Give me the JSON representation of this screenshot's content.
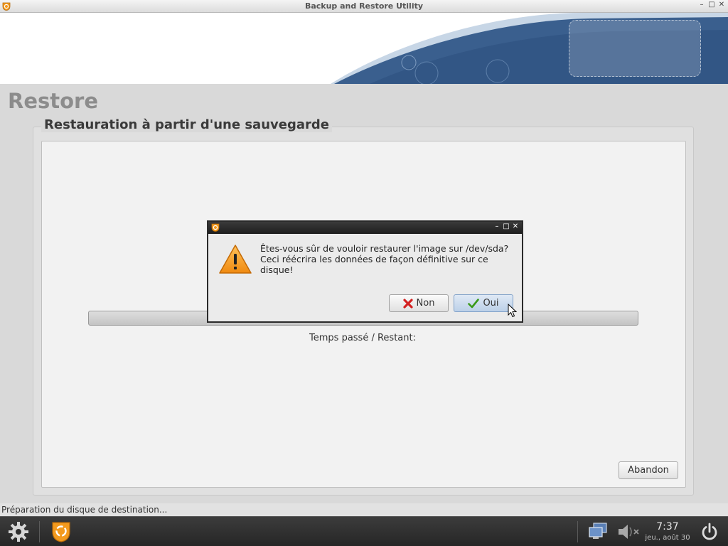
{
  "window": {
    "title": "Backup and Restore Utility",
    "controls": [
      "minimize",
      "maximize",
      "close"
    ]
  },
  "colors": {
    "banner_blue": "#3a5f8e",
    "accent_orange": "#f39a1e",
    "taskbar": "#2e2e2e"
  },
  "page": {
    "heading": "Restore",
    "section_title": "Restauration à partir d'une sauvegarde",
    "progress": 0,
    "time_label": "Temps passé / Restant:",
    "abort_button": "Abandon"
  },
  "status": {
    "text": "Préparation du disque de destination..."
  },
  "dialog": {
    "icon": "warning-icon",
    "message_line1": "Êtes-vous sûr de vouloir restaurer l'image sur /dev/sda?",
    "message_line2": "Ceci réécrira les données de façon définitive sur ce disque!",
    "no_button": "Non",
    "yes_button": "Oui"
  },
  "taskbar": {
    "clock_time": "7:37",
    "clock_date": "jeu., août 30",
    "icons": [
      "settings-icon",
      "redo-app-icon",
      "network-icon",
      "volume-muted-icon",
      "power-icon"
    ]
  }
}
